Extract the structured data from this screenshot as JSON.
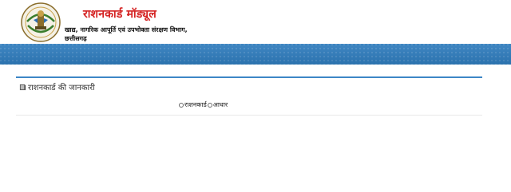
{
  "header": {
    "title": "राशनकार्ड मॉड्यूल",
    "department_line1": "खाद्य, नागरिक आपूर्ति एवं उपभोक्ता संरक्षण विभाग,",
    "department_line2": "छत्तीसगढ़",
    "emblem_icon": "chhattisgarh-emblem-icon"
  },
  "panel": {
    "title": "राशनकार्ड की जानकारी",
    "title_icon": "book-icon",
    "options": [
      "राशनकार्ड",
      "आधार"
    ]
  },
  "colors": {
    "title_red": "#d42020",
    "band_blue": "#2f7cbd",
    "panel_border": "#3d86c6"
  }
}
